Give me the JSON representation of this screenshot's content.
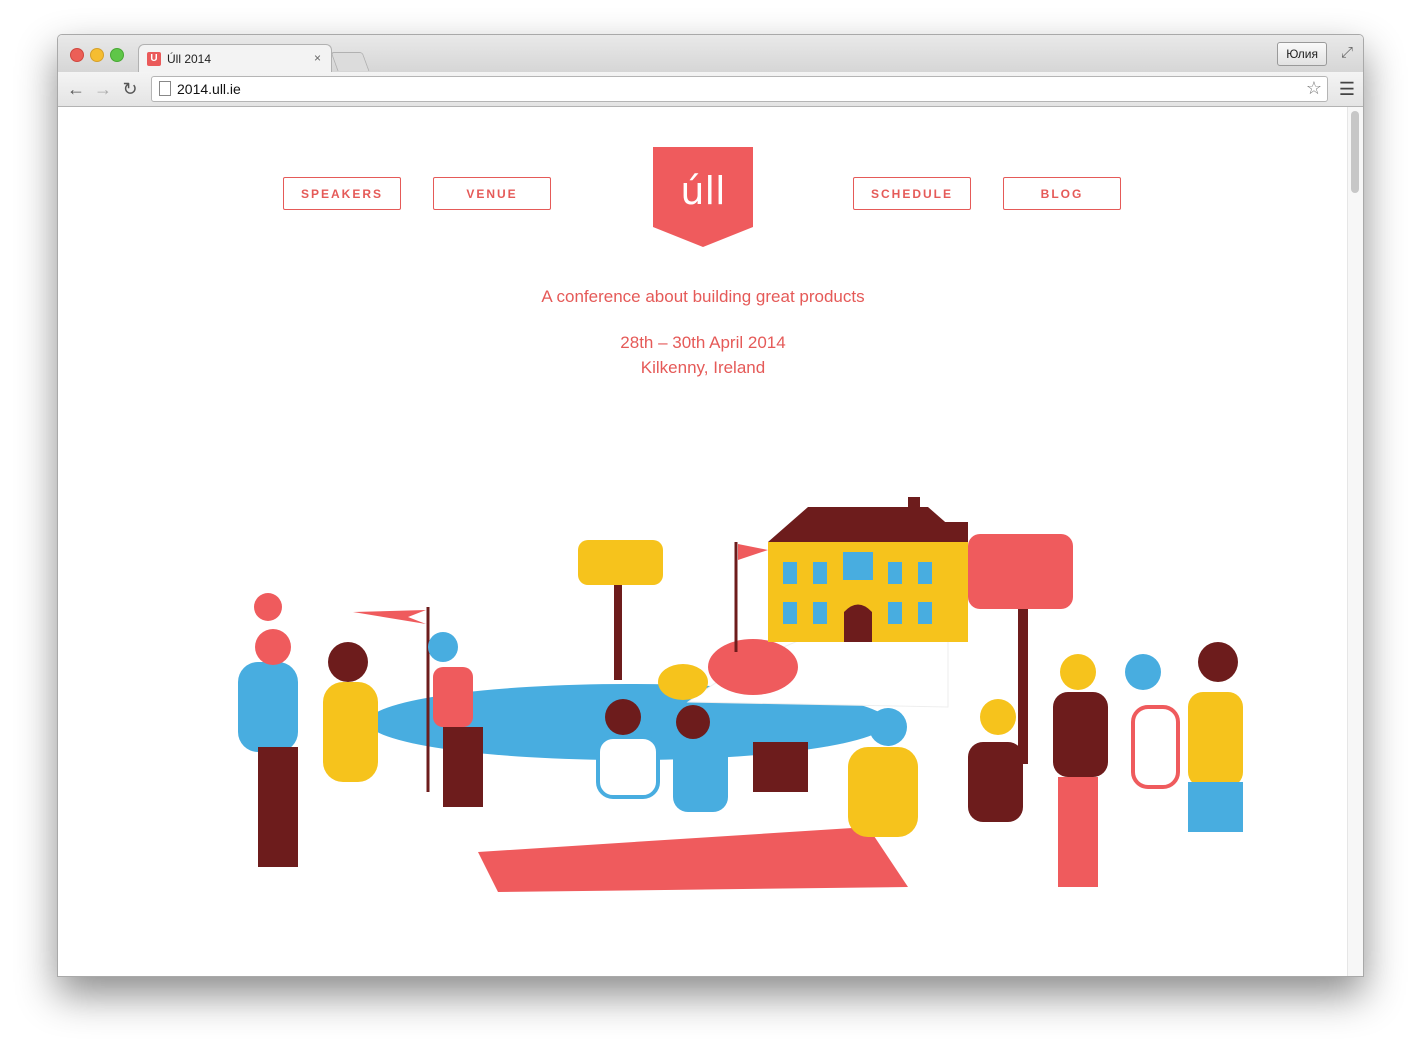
{
  "browser": {
    "tab_title": "Úll 2014",
    "tab_favicon": "U",
    "tab_close": "×",
    "user_label": "Юлия",
    "url": "2014.ull.ie",
    "icons": {
      "back": "arrow-left-icon",
      "forward": "arrow-right-icon",
      "reload": "reload-icon",
      "star": "star-icon",
      "menu": "hamburger-menu-icon",
      "fullscreen": "expand-icon"
    }
  },
  "nav": {
    "speakers": "SPEAKERS",
    "venue": "VENUE",
    "schedule": "SCHEDULE",
    "blog": "BLOG"
  },
  "logo": {
    "text": "úll"
  },
  "hero": {
    "tagline": "A conference about building great products",
    "dates": "28th – 30th April 2014",
    "location": "Kilkenny, Ireland"
  },
  "colors": {
    "accent": "#e55a58",
    "yellow": "#f6c31c",
    "blue": "#48ade0",
    "maroon": "#6d1c1c"
  }
}
